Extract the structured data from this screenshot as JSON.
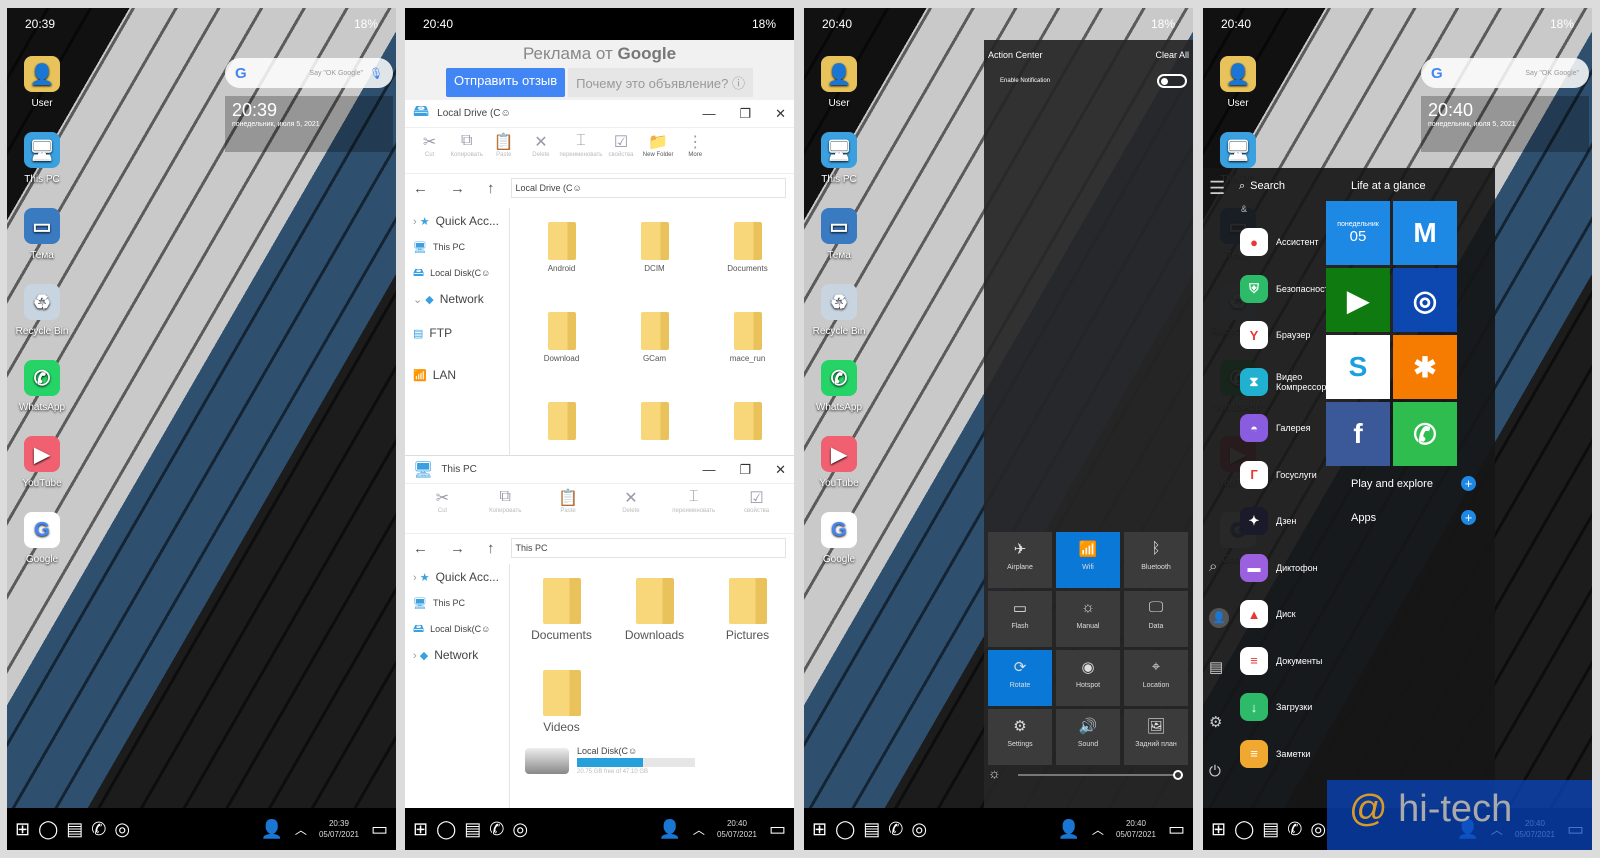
{
  "status": {
    "time_home": "20:39",
    "time": "20:40",
    "battery": "18%"
  },
  "taskbar": {
    "date": "05/07/2021",
    "time_home": "20:39",
    "time": "20:40"
  },
  "desktop": {
    "icons": [
      {
        "label": "User",
        "color": "#e8c25a",
        "glyph": "👤"
      },
      {
        "label": "This PC",
        "color": "#3aa0e0",
        "glyph": "🖥"
      },
      {
        "label": "Тема",
        "color": "#3a7ac0",
        "glyph": "▭"
      },
      {
        "label": "Recycle Bin",
        "color": "#c8d4e0",
        "glyph": "♻"
      },
      {
        "label": "WhatsApp",
        "color": "#25d366",
        "glyph": "✆"
      },
      {
        "label": "YouTube",
        "color": "#f06070",
        "glyph": "▶"
      },
      {
        "label": "Google",
        "color": "#ffffff",
        "glyph": "G"
      }
    ]
  },
  "widget": {
    "search_placeholder": "Say \"OK Google\"",
    "clock": "20:39",
    "date": "понедельник, июля 5, 2021"
  },
  "explorer": {
    "ad": {
      "title_prefix": "Реклама от",
      "title_brand": "Google",
      "feedback": "Отправить отзыв",
      "why": "Почему это объявление? ⓘ"
    },
    "window1": {
      "title": "Local Drive (C☺",
      "address": "Local Drive (C☺",
      "toolbar": [
        "Cut",
        "Копировать",
        "Paste",
        "Delete",
        "переименовать",
        "свойства",
        "New Folder",
        "More"
      ],
      "sidebar": [
        "Quick Acc...",
        "This PC",
        "Local Disk(C☺",
        "Network",
        "FTP",
        "LAN"
      ],
      "folders": [
        "Android",
        "DCIM",
        "Documents",
        "Download",
        "GCam",
        "mace_run",
        "",
        "",
        ""
      ]
    },
    "window2": {
      "title": "This PC",
      "address": "This PC",
      "toolbar": [
        "Cut",
        "Копировать",
        "Paste",
        "Delete",
        "переименовать",
        "свойства"
      ],
      "sidebar": [
        "Quick Acc...",
        "This PC",
        "Local Disk(C☺",
        "Network"
      ],
      "folders": [
        "Documents",
        "Downloads",
        "Pictures",
        "Videos"
      ],
      "drive": {
        "label": "Local Disk(C☺",
        "free_text": "20.75 GB free of 47.10 GB",
        "used_fraction": 0.56
      }
    }
  },
  "action_center": {
    "title": "Action Center",
    "clear_all": "Clear All",
    "enable_notification": "Enable Notification",
    "notifications_enabled": false,
    "tiles": [
      {
        "label": "Airplane",
        "icon": "✈",
        "active": false
      },
      {
        "label": "Wifi",
        "icon": "📶",
        "active": true
      },
      {
        "label": "Bluetooth",
        "icon": "ᛒ",
        "active": false
      },
      {
        "label": "Flash",
        "icon": "▭",
        "active": false
      },
      {
        "label": "Manual",
        "icon": "☼",
        "active": false
      },
      {
        "label": "Data",
        "icon": "🖵",
        "active": false
      },
      {
        "label": "Rotate",
        "icon": "⟳",
        "active": true
      },
      {
        "label": "Hotspot",
        "icon": "◉",
        "active": false
      },
      {
        "label": "Location",
        "icon": "⌖",
        "active": false
      },
      {
        "label": "Settings",
        "icon": "⚙",
        "active": false
      },
      {
        "label": "Sound",
        "icon": "🔊",
        "active": false
      },
      {
        "label": "Задний план",
        "icon": "🖼",
        "active": false
      }
    ],
    "brightness": 1.0,
    "accent": "#0a78d7"
  },
  "start": {
    "search": "Search",
    "section_letter": "&",
    "life": "Life at a glance",
    "play": "Play and explore",
    "apps_label": "Apps",
    "apps": [
      {
        "label": "Ассистент",
        "color": "#ffffff",
        "glyph": "●"
      },
      {
        "label": "Безопасность",
        "color": "#2dbb6a",
        "glyph": "⛨"
      },
      {
        "label": "Браузер",
        "color": "#ffffff",
        "glyph": "Y"
      },
      {
        "label": "Видео Компрессор",
        "color": "#20b0d0",
        "glyph": "⧗"
      },
      {
        "label": "Галерея",
        "color": "#8a5ce0",
        "glyph": "◓"
      },
      {
        "label": "Госуслуги",
        "color": "#ffffff",
        "glyph": "Г"
      },
      {
        "label": "Дзен",
        "color": "#1a1a2a",
        "glyph": "✦"
      },
      {
        "label": "Диктофон",
        "color": "#9a60e0",
        "glyph": "▬"
      },
      {
        "label": "Диск",
        "color": "#ffffff",
        "glyph": "▲"
      },
      {
        "label": "Документы",
        "color": "#ffffff",
        "glyph": "≡"
      },
      {
        "label": "Загрузки",
        "color": "#2dbb6a",
        "glyph": "↓"
      },
      {
        "label": "Заметки",
        "color": "#f0a830",
        "glyph": "≡"
      }
    ],
    "tiles": [
      {
        "name": "calendar",
        "day": "понедельник",
        "date": "05",
        "color": "#1e88e5"
      },
      {
        "name": "gmail",
        "glyph": "M",
        "color": "#1e88e5"
      },
      {
        "name": "play-store",
        "glyph": "▶",
        "color": "#0f7a10"
      },
      {
        "name": "camera",
        "glyph": "◎",
        "color": "#0d47b0"
      },
      {
        "name": "skype",
        "glyph": "S",
        "color": "#ffffff"
      },
      {
        "name": "photos",
        "glyph": "✱",
        "color": "#f57c00"
      },
      {
        "name": "facebook",
        "glyph": "f",
        "color": "#3b5998"
      },
      {
        "name": "whatsapp",
        "glyph": "✆",
        "color": "#2ebd4e"
      }
    ]
  },
  "watermark": {
    "at": "@",
    "text": "hi-tech"
  }
}
